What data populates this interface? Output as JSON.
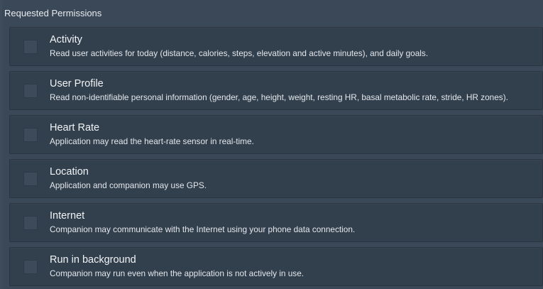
{
  "section": {
    "title": "Requested Permissions"
  },
  "permissions": [
    {
      "title": "Activity",
      "description": "Read user activities for today (distance, calories, steps, elevation and active minutes), and daily goals.",
      "checked": false
    },
    {
      "title": "User Profile",
      "description": "Read non-identifiable personal information (gender, age, height, weight, resting HR, basal metabolic rate, stride, HR zones).",
      "checked": false
    },
    {
      "title": "Heart Rate",
      "description": "Application may read the heart-rate sensor in real-time.",
      "checked": false
    },
    {
      "title": "Location",
      "description": "Application and companion may use GPS.",
      "checked": false
    },
    {
      "title": "Internet",
      "description": "Companion may communicate with the Internet using your phone data connection.",
      "checked": false
    },
    {
      "title": "Run in background",
      "description": "Companion may run even when the application is not actively in use.",
      "checked": false
    }
  ]
}
